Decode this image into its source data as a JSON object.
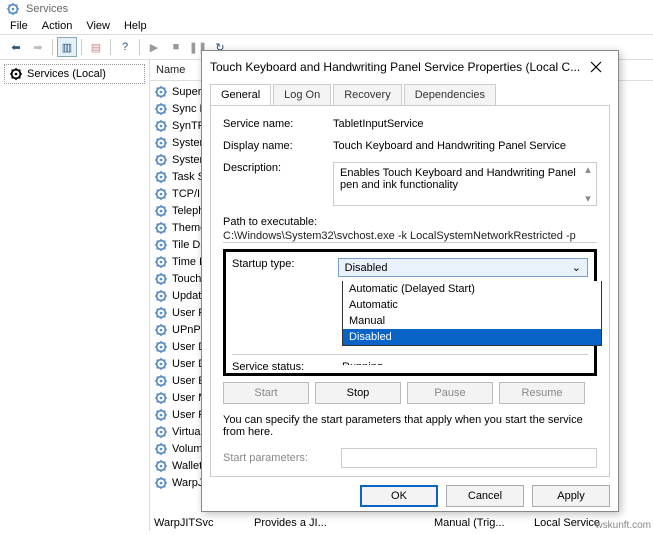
{
  "window": {
    "title": "Services"
  },
  "menu": {
    "file": "File",
    "action": "Action",
    "view": "View",
    "help": "Help"
  },
  "left": {
    "node": "Services (Local)"
  },
  "columns": {
    "name": "Name"
  },
  "services": [
    "Superfetc",
    "Sync Hos",
    "SynTPEnh",
    "System Ev",
    "System Ev",
    "Task Sche",
    "TCP/IP Ne",
    "Telephony",
    "Themes",
    "Tile Data",
    "Time Brok",
    "Touch Ke",
    "Update O",
    "User Profi",
    "UPnP De",
    "User Data",
    "User Data",
    "User Expe",
    "User Man",
    "User Profi",
    "Virtual Dis",
    "Volume S",
    "WalletSer",
    "WarpJITSvc"
  ],
  "detail": {
    "name": "WarpJITSvc",
    "desc": "Provides a JI...",
    "status": "",
    "startup": "Manual (Trig...",
    "logon": "Local Service"
  },
  "credit": "wskunft.com",
  "dialog": {
    "title": "Touch Keyboard and Handwriting Panel Service Properties (Local C...",
    "tabs": {
      "general": "General",
      "logon": "Log On",
      "recovery": "Recovery",
      "deps": "Dependencies"
    },
    "service_name_lbl": "Service name:",
    "service_name": "TabletInputService",
    "display_name_lbl": "Display name:",
    "display_name": "Touch Keyboard and Handwriting Panel Service",
    "description_lbl": "Description:",
    "description": "Enables Touch Keyboard and Handwriting Panel pen and ink functionality",
    "path_lbl": "Path to executable:",
    "path": "C:\\Windows\\System32\\svchost.exe -k LocalSystemNetworkRestricted -p",
    "startup_lbl": "Startup type:",
    "startup_value": "Disabled",
    "startup_options": [
      "Automatic (Delayed Start)",
      "Automatic",
      "Manual",
      "Disabled"
    ],
    "status_lbl": "Service status:",
    "status_value": "Running",
    "btn_start": "Start",
    "btn_stop": "Stop",
    "btn_pause": "Pause",
    "btn_resume": "Resume",
    "hint": "You can specify the start parameters that apply when you start the service from here.",
    "params_lbl": "Start parameters:",
    "ok": "OK",
    "cancel": "Cancel",
    "apply": "Apply"
  }
}
